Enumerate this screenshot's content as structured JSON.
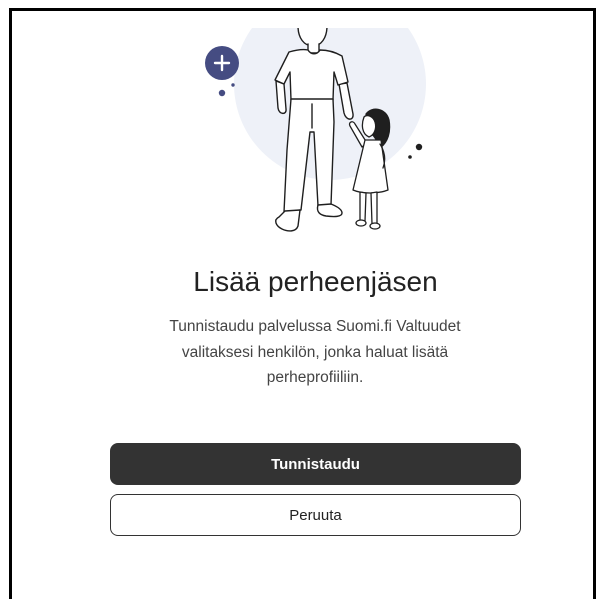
{
  "dialog": {
    "illustration": {
      "icon": "family-illustration",
      "badge_icon": "plus-icon",
      "colors": {
        "badge": "#454c82",
        "backdrop": "#eef1f8",
        "ink": "#1f1f1f"
      }
    },
    "title": "Lisää perheenjäsen",
    "description": "Tunnistaudu palvelussa Suomi.fi Valtuudet valitaksesi henkilön, jonka haluat lisätä perheprofiiliin.",
    "actions": {
      "primary": {
        "label": "Tunnistaudu",
        "background": "#333333",
        "color": "#ffffff"
      },
      "secondary": {
        "label": "Peruuta",
        "border": "#333333"
      }
    }
  }
}
